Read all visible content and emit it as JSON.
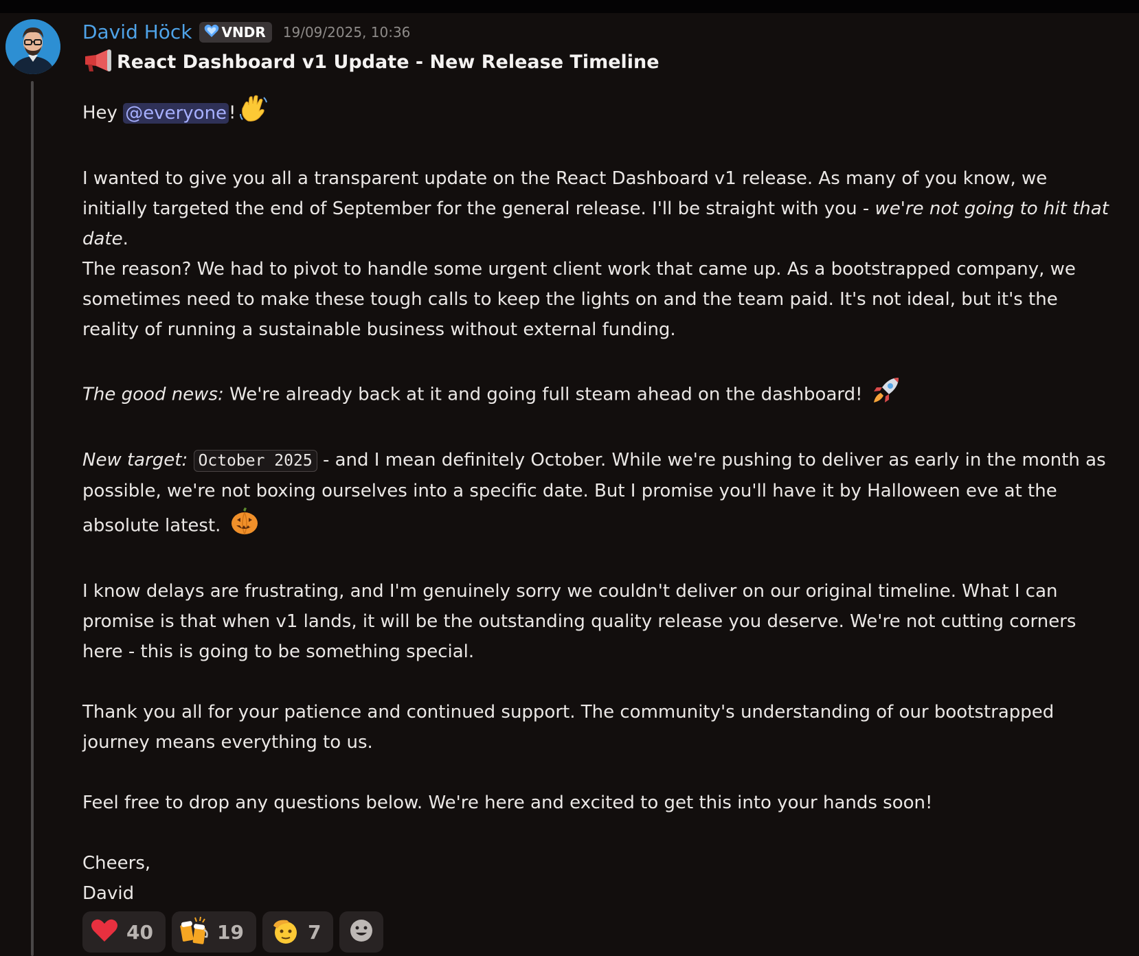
{
  "message": {
    "author": "David Höck",
    "tag": "VNDR",
    "timestamp": "19/09/2025, 10:36",
    "title": "React Dashboard v1 Update - New Release Timeline",
    "body": {
      "greeting_prefix": "Hey ",
      "mention": "@everyone",
      "greeting_suffix": "!",
      "p1_text": "I wanted to give you all a transparent update on the React Dashboard v1 release. As many of you know, we initially targeted the end of September for the general release. I'll be straight with you - ",
      "p1_italic": "we're not going to hit that date",
      "p1_end": ".",
      "p2": "The reason? We had to pivot to handle some urgent client work that came up. As a bootstrapped company, we sometimes need to make these tough calls to keep the lights on and the team paid. It's not ideal, but it's the reality of running a sustainable business without external funding.",
      "p3_italic": "The good news:",
      "p3_text": " We're already back at it and going full steam ahead on the dashboard! ",
      "p4_italic": "New target:",
      "p4_code": "October 2025",
      "p4_text": " - and I mean definitely October. While we're pushing to deliver as early in the month as possible, we're not boxing ourselves into a specific date. But I promise you'll have it by Halloween eve at the absolute latest. ",
      "p5": "I know delays are frustrating, and I'm genuinely sorry we couldn't deliver on our original timeline. What I can promise is that when v1 lands, it will be the outstanding quality release you deserve. We're not cutting corners here - this is going to be something special.",
      "p6": "Thank you all for your patience and continued support. The community's understanding of our bootstrapped journey means everything to us.",
      "p7": "Feel free to drop any questions below. We're here and excited to get this into your hands soon!",
      "signoff": "Cheers,",
      "signature": "David"
    }
  },
  "reactions": [
    {
      "icon": "heart-icon",
      "count": "40"
    },
    {
      "icon": "beers-icon",
      "count": "19"
    },
    {
      "icon": "saluting-face-icon",
      "count": "7"
    }
  ],
  "colors": {
    "background": "#120e0d",
    "author": "#4fa3e8",
    "mention_bg": "#2f3157",
    "mention_text": "#a7b0ff",
    "reaction_bg": "#282323"
  }
}
